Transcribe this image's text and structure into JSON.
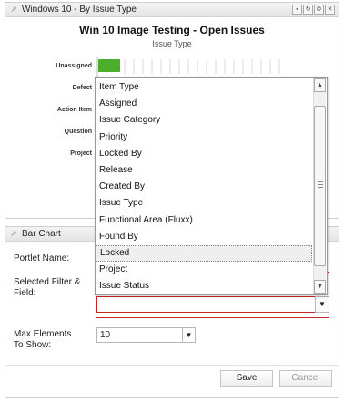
{
  "portlet1": {
    "title": "Windows 10 - By Issue Type",
    "chart_title": "Win 10 Image Testing - Open Issues",
    "chart_subtitle": "Issue Type",
    "controls": [
      "pin-icon",
      "refresh-icon",
      "settings-icon",
      "close-icon"
    ]
  },
  "chart_data": {
    "type": "bar",
    "orientation": "horizontal",
    "title": "Win 10 Image Testing - Open Issues",
    "subtitle": "Issue Type",
    "categories": [
      "Unassigned",
      "Defect",
      "Action Item",
      "Question",
      "Project"
    ],
    "values": [
      4,
      0,
      0,
      0,
      0
    ],
    "bar_color": "#4caf2a",
    "grid": true
  },
  "dropdown": {
    "items": [
      "Item Type",
      "Assigned",
      "Issue Category",
      "Priority",
      "Locked By",
      "Release",
      "Created By",
      "Issue Type",
      "Functional Area (Fluxx)",
      "Found By",
      "Locked",
      "Project",
      "Issue Status"
    ],
    "highlighted": "Locked"
  },
  "portlet2": {
    "title": "Bar Chart",
    "portlet_name_label": "Portlet Name:",
    "filter_label_line1": "Selected Filter &",
    "filter_label_line2": "Field:",
    "filter_value": "",
    "max_label_line1": "Max Elements",
    "max_label_line2": "To Show:",
    "max_value": "10",
    "save_label": "Save",
    "cancel_label": "Cancel"
  },
  "colors": {
    "error_border": "#c62828",
    "bar": "#4caf2a"
  }
}
